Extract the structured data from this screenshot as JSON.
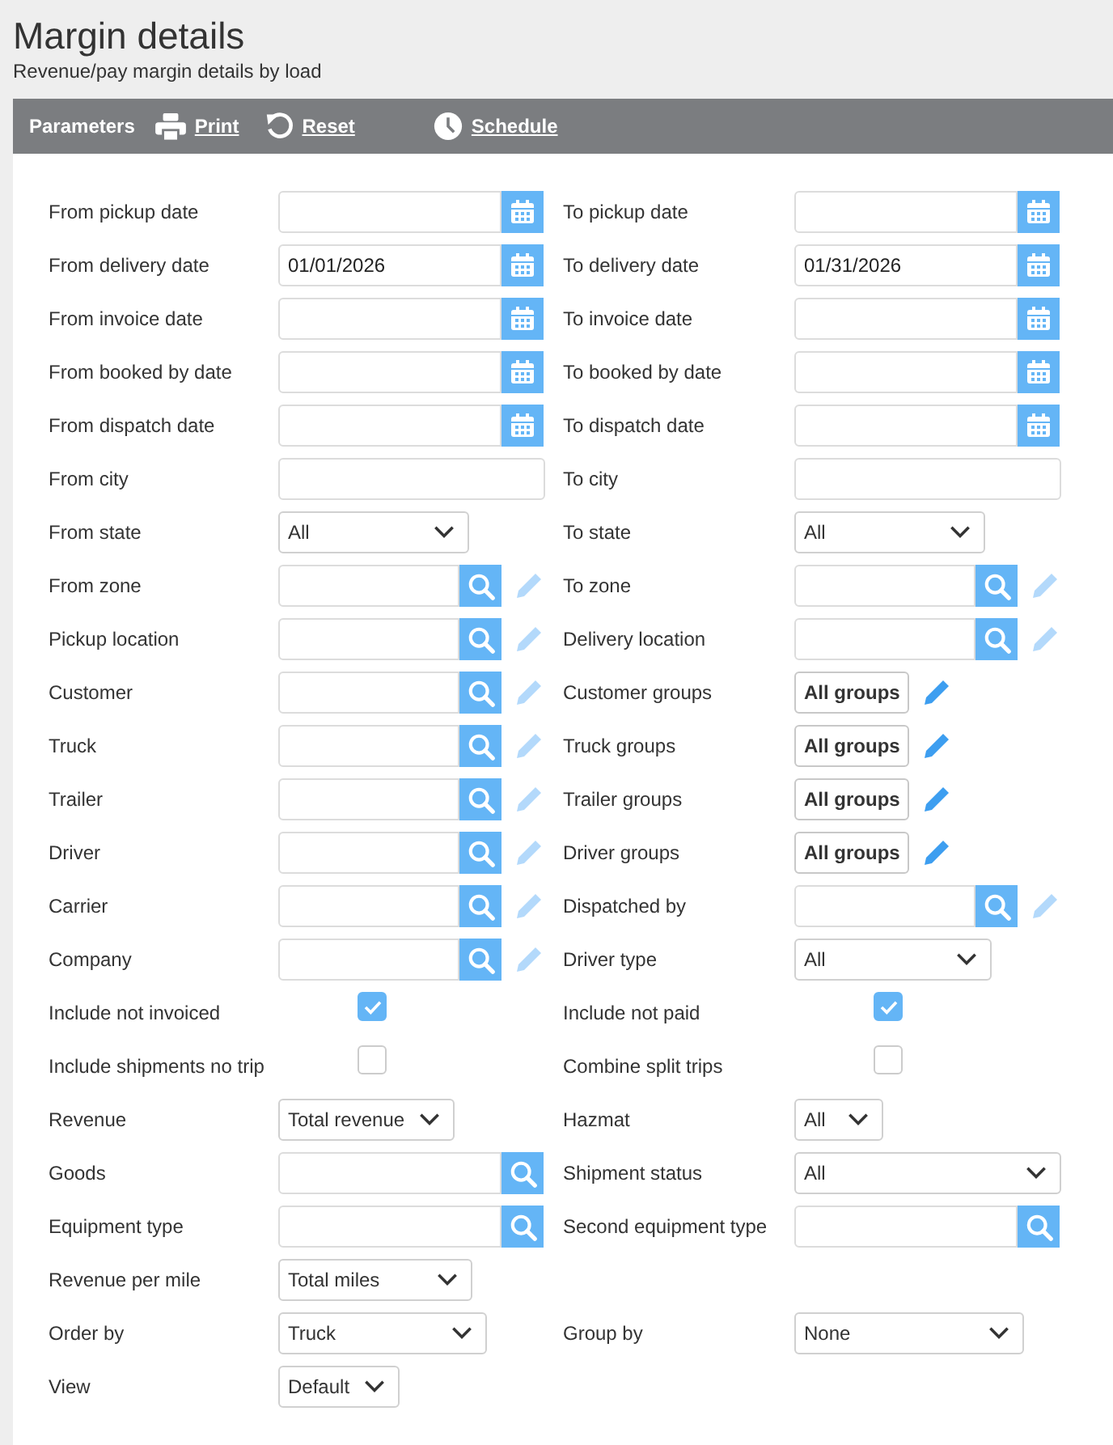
{
  "header": {
    "title": "Margin details",
    "subtitle": "Revenue/pay margin details by load"
  },
  "toolbar": [
    {
      "kind": "heading",
      "text": "Parameters"
    },
    {
      "kind": "print",
      "text": "Print"
    },
    {
      "kind": "reset",
      "text": "Reset"
    },
    {
      "kind": "schedule",
      "text": "Schedule"
    }
  ],
  "rows": [
    {
      "left": {
        "label": "From pickup date",
        "kind": "date"
      },
      "right": {
        "label": "To pickup date",
        "kind": "date"
      }
    },
    {
      "left": {
        "label": "From delivery date",
        "kind": "date",
        "value": "01/01/2026"
      },
      "right": {
        "label": "To delivery date",
        "kind": "date",
        "value": "01/31/2026"
      }
    },
    {
      "left": {
        "label": "From invoice date",
        "kind": "date"
      },
      "right": {
        "label": "To invoice date",
        "kind": "date"
      }
    },
    {
      "left": {
        "label": "From booked by date",
        "kind": "date"
      },
      "right": {
        "label": "To booked by date",
        "kind": "date"
      }
    },
    {
      "left": {
        "label": "From dispatch date",
        "kind": "date"
      },
      "right": {
        "label": "To dispatch date",
        "kind": "date"
      }
    },
    {
      "left": {
        "label": "From city",
        "kind": "text"
      },
      "right": {
        "label": "To city",
        "kind": "text"
      }
    },
    {
      "left": {
        "label": "From state",
        "kind": "select",
        "value": "All"
      },
      "right": {
        "label": "To state",
        "kind": "select",
        "value": "All"
      }
    },
    {
      "left": {
        "label": "From zone",
        "kind": "lookup",
        "edit_disabled": true
      },
      "right": {
        "label": "To zone",
        "kind": "lookup",
        "edit_disabled": true
      }
    },
    {
      "left": {
        "label": "Pickup location",
        "kind": "lookup",
        "edit_disabled": true
      },
      "right": {
        "label": "Delivery location",
        "kind": "lookup",
        "edit_disabled": true
      }
    },
    {
      "left": {
        "label": "Customer",
        "kind": "lookup",
        "edit_disabled": true
      },
      "right": {
        "label": "Customer groups",
        "kind": "groups",
        "value": "All groups",
        "edit_disabled": false
      }
    },
    {
      "left": {
        "label": "Truck",
        "kind": "lookup",
        "edit_disabled": true
      },
      "right": {
        "label": "Truck groups",
        "kind": "groups",
        "value": "All groups",
        "edit_disabled": false
      }
    },
    {
      "left": {
        "label": "Trailer",
        "kind": "lookup",
        "edit_disabled": true
      },
      "right": {
        "label": "Trailer groups",
        "kind": "groups",
        "value": "All groups",
        "edit_disabled": false
      }
    },
    {
      "left": {
        "label": "Driver",
        "kind": "lookup",
        "edit_disabled": true
      },
      "right": {
        "label": "Driver groups",
        "kind": "groups",
        "value": "All groups",
        "edit_disabled": false
      }
    },
    {
      "left": {
        "label": "Carrier",
        "kind": "lookup",
        "edit_disabled": true
      },
      "right": {
        "label": "Dispatched by",
        "kind": "lookup",
        "edit_disabled": true
      }
    },
    {
      "left": {
        "label": "Company",
        "kind": "lookup",
        "edit_disabled": true
      },
      "right": {
        "label": "Driver type",
        "kind": "select",
        "value": "All"
      }
    },
    {
      "left": {
        "label": "Include not invoiced",
        "kind": "checkbox",
        "checked": true
      },
      "right": {
        "label": "Include not paid",
        "kind": "checkbox",
        "checked": true
      }
    },
    {
      "left": {
        "label": "Include shipments no trip",
        "kind": "checkbox",
        "checked": false
      },
      "right": {
        "label": "Combine split trips",
        "kind": "checkbox",
        "checked": false
      }
    },
    {
      "left": {
        "label": "Revenue",
        "kind": "select",
        "value": "Total revenue"
      },
      "right": {
        "label": "Hazmat",
        "kind": "select",
        "value": "All"
      }
    },
    {
      "left": {
        "label": "Goods",
        "kind": "search"
      },
      "right": {
        "label": "Shipment status",
        "kind": "select",
        "value": "All"
      }
    },
    {
      "left": {
        "label": "Equipment type",
        "kind": "search"
      },
      "right": {
        "label": "Second equipment type",
        "kind": "search"
      }
    },
    {
      "left": {
        "label": "Revenue per mile",
        "kind": "select",
        "value": "Total miles"
      }
    },
    {
      "left": {
        "label": "Order by",
        "kind": "select",
        "value": "Truck"
      },
      "right": {
        "label": "Group by",
        "kind": "select",
        "value": "None"
      }
    },
    {
      "left": {
        "label": "View",
        "kind": "select",
        "value": "Default"
      }
    }
  ]
}
